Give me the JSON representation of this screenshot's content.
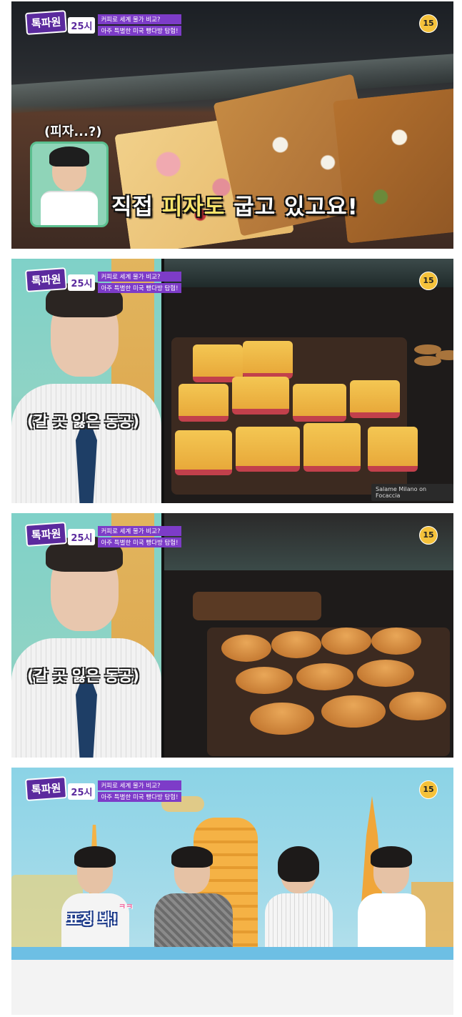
{
  "show": {
    "logo_main": "톡파원",
    "logo_num": "25시",
    "sub_line1": "커피로 세계 물가 비교?",
    "sub_line2": "아주 특별한 미국 빵다방 탐험!",
    "rating": "15"
  },
  "frame1": {
    "thumb_label": "(피자...?)",
    "subtitle_white1": "직접 ",
    "subtitle_yellow": "피자도",
    "subtitle_white2": " 굽고 있고요!"
  },
  "frame2": {
    "caption": "(갈 곳 잃은 동공)",
    "label_card": "Salame Milano on Focaccia"
  },
  "frame3": {
    "caption": "(갈 곳 잃은 동공)"
  },
  "frame4": {
    "caption": "표정 봐!",
    "caption_sub": "ㅋㅋ"
  }
}
